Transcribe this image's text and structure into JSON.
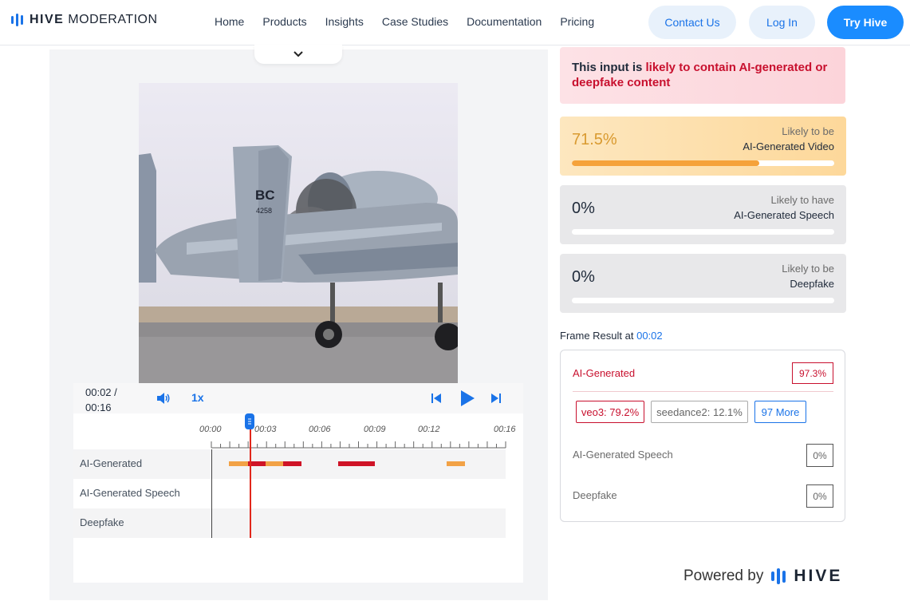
{
  "nav": {
    "logo_bold": "HIVE",
    "logo_rest": "MODERATION",
    "links": [
      "Home",
      "Products",
      "Insights",
      "Case Studies",
      "Documentation",
      "Pricing"
    ],
    "contact": "Contact Us",
    "login": "Log In",
    "try": "Try Hive"
  },
  "player": {
    "current": "00:02 /",
    "duration": "00:16",
    "speed": "1x",
    "ticks": [
      "00:00",
      "00:03",
      "00:06",
      "00:09",
      "00:12",
      "00:16"
    ],
    "rows": [
      "AI-Generated",
      "AI-Generated Speech",
      "Deepfake"
    ],
    "playhead_time_s": 2
  },
  "result": {
    "alert_prefix": "This input is ",
    "alert_highlight": "likely to contain AI-generated or deepfake content",
    "cards": [
      {
        "pct": "71.5%",
        "line1": "Likely to be",
        "line2": "AI-Generated Video",
        "fraction": 0.715
      },
      {
        "pct": "0%",
        "line1": "Likely to have",
        "line2": "AI-Generated Speech",
        "fraction": 0
      },
      {
        "pct": "0%",
        "line1": "Likely to be",
        "line2": "Deepfake",
        "fraction": 0
      }
    ],
    "frame_prefix": "Frame Result at ",
    "frame_time": "00:02",
    "ai_label": "AI-Generated",
    "ai_value": "97.3%",
    "chips": [
      "veo3: 79.2%",
      "seedance2: 12.1%",
      "97 More"
    ],
    "speech_label": "AI-Generated Speech",
    "speech_value": "0%",
    "deepfake_label": "Deepfake",
    "deepfake_value": "0%"
  },
  "footer": {
    "powered_by": "Powered by",
    "brand": "HIVE"
  },
  "colors": {
    "accent": "#1a73e8",
    "danger": "#c8102e",
    "warn": "#f5a23a",
    "danger_bar": "#d0162a"
  }
}
